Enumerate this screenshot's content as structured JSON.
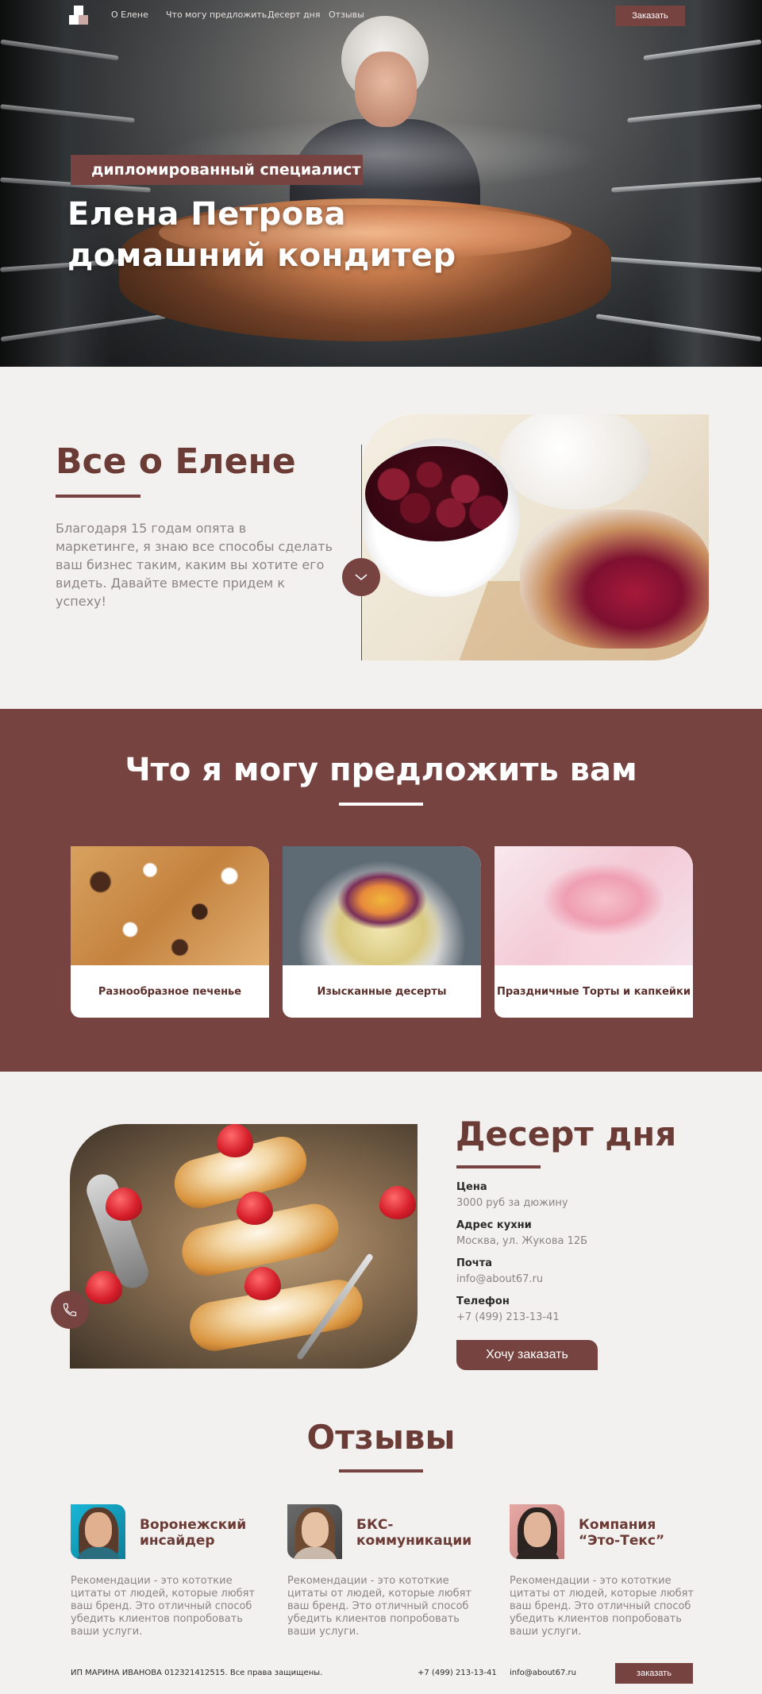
{
  "nav": {
    "links": [
      "О Елене",
      "Что могу предложить",
      "Десерт дня",
      "Отзывы"
    ],
    "order_button": "Заказать"
  },
  "hero": {
    "badge": "дипломированный специалист",
    "title_line1": "Елена Петрова",
    "title_line2": "домашний кондитер"
  },
  "about": {
    "title": "Все о Елене",
    "text": "Благодаря 15 годам опята в маркетинге, я знаю все способы сделать ваш бизнес таким, каким вы хотите его видеть. Давайте вместе придем к успеху!",
    "scroll_icon": "chevron-down-icon"
  },
  "offers": {
    "title": "Что я могу предложить вам",
    "cards": [
      {
        "label": "Разнообразное печенье"
      },
      {
        "label": "Изысканные десерты"
      },
      {
        "label": "Праздничные Торты и капкейки"
      }
    ]
  },
  "dessert": {
    "title": "Десерт дня",
    "fields": [
      {
        "label": "Цена",
        "value": "3000 руб за дюжину"
      },
      {
        "label": "Адрес кухни",
        "value": "Москва, ул. Жукова 12Б"
      },
      {
        "label": "Почта",
        "value": "info@about67.ru"
      },
      {
        "label": "Телефон",
        "value": "+7 (499) 213-13-41"
      }
    ],
    "order_button": "Хочу заказать",
    "phone_icon": "phone-icon"
  },
  "reviews": {
    "title": "Отзывы",
    "items": [
      {
        "company": "Воронежский инсайдер",
        "text": "Рекомендации - это кототкие цитаты от людей, которые любят ваш бренд. Это отличный способ убедить клиентов попробовать ваши услуги."
      },
      {
        "company": "БКС-коммуникации",
        "text": "Рекомендации - это кототкие цитаты от людей, которые любят ваш бренд. Это отличный способ убедить клиентов попробовать ваши услуги."
      },
      {
        "company": "Компания “Это-Текс”",
        "text": "Рекомендации - это кототкие цитаты от людей, которые любят ваш бренд. Это отличный способ убедить клиентов попробовать ваши услуги."
      }
    ]
  },
  "footer": {
    "copyright": "ИП МАРИНА ИВАНОВА 012321412515. Все права защищены.",
    "phone": "+7 (499) 213-13-41",
    "email": "info@about67.ru",
    "order_button": "заказать"
  },
  "colors": {
    "brand": "#774340",
    "background": "#f3f0f0",
    "heading": "#6b3b36",
    "muted_text": "#8c8585"
  }
}
